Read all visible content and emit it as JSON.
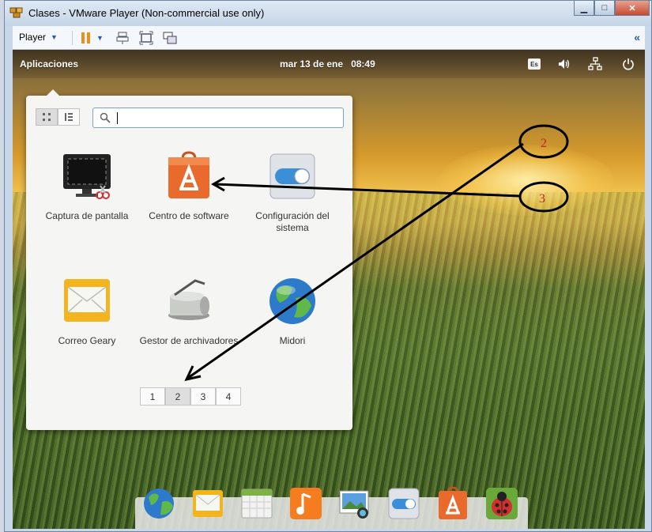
{
  "window": {
    "title": "Clases - VMware Player (Non-commercial use only)",
    "controls": {
      "minimize": "▁",
      "maximize": "□",
      "close": "✕"
    }
  },
  "toolbar": {
    "player_label": "Player",
    "collapse_glyph": "«"
  },
  "panel": {
    "applications_label": "Aplicaciones",
    "date": "mar 13 de ene",
    "time": "08:49",
    "keyboard_layout": "Es"
  },
  "launcher": {
    "search": {
      "value": "",
      "placeholder": ""
    },
    "apps": [
      {
        "label": "Captura de pantalla",
        "icon": "screenshot-icon"
      },
      {
        "label": "Centro de software",
        "icon": "software-center-icon"
      },
      {
        "label": "Configuración del sistema",
        "icon": "settings-toggle-icon"
      },
      {
        "label": "Correo Geary",
        "icon": "mail-icon"
      },
      {
        "label": "Gestor de archivadores",
        "icon": "archive-manager-icon"
      },
      {
        "label": "Midori",
        "icon": "globe-icon"
      }
    ],
    "pages": [
      "1",
      "2",
      "3",
      "4"
    ],
    "active_page": "2"
  },
  "dock": {
    "items": [
      "midori-icon",
      "mail-icon",
      "calendar-icon",
      "music-icon",
      "photos-icon",
      "settings-toggle-icon",
      "software-center-icon",
      "bug-icon"
    ]
  },
  "annotations": {
    "circle_2": "2",
    "circle_3": "3",
    "colors": {
      "stroke": "#000000",
      "text": "#c0241a"
    }
  }
}
